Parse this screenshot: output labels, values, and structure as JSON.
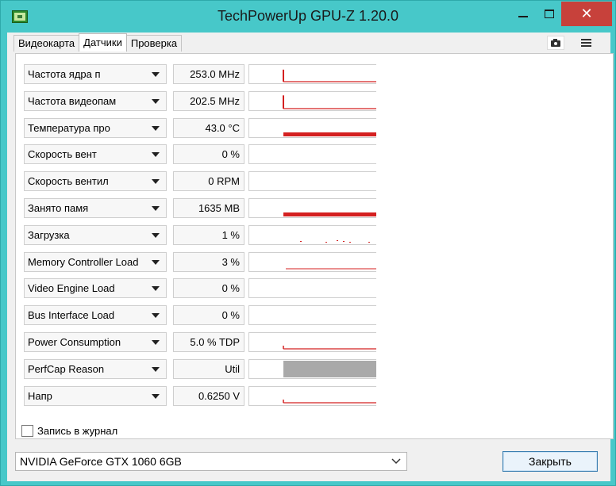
{
  "window": {
    "title": "TechPowerUp GPU-Z 1.20.0",
    "minimize_label": "",
    "maximize_label": "",
    "close_label": "✕"
  },
  "tabs": [
    {
      "label": "Видеокарта",
      "active": false
    },
    {
      "label": "Датчики",
      "active": true
    },
    {
      "label": "Проверка",
      "active": false
    }
  ],
  "toolbar": {
    "screenshot_icon": "camera-icon",
    "menu_icon": "hamburger-menu-icon"
  },
  "colors": {
    "graph_line": "#d42020",
    "perfcap_fill": "#a9a9a9",
    "titlebar": "#47c8c9",
    "close_button": "#c7413b"
  },
  "sensors": [
    {
      "name": "Частота ядра п",
      "value": "253.0 MHz",
      "graph": {
        "kind": "spike-low",
        "level": 0.78
      }
    },
    {
      "name": "Частота видеопам",
      "value": "202.5 MHz",
      "graph": {
        "kind": "spike-low",
        "level": 0.85
      }
    },
    {
      "name": "Температура про",
      "value": "43.0 °C",
      "graph": {
        "kind": "band",
        "level": 0.43
      }
    },
    {
      "name": "Скорость вент",
      "value": "0 %",
      "graph": {
        "kind": "none",
        "level": 0
      }
    },
    {
      "name": "Скорость вентил",
      "value": "0 RPM",
      "graph": {
        "kind": "none",
        "level": 0
      }
    },
    {
      "name": "Занято памя",
      "value": "1635 MB",
      "graph": {
        "kind": "band",
        "level": 0.27
      }
    },
    {
      "name": "Загрузка",
      "value": "1 %",
      "graph": {
        "kind": "dots",
        "level": 0.01
      }
    },
    {
      "name": "Memory Controller Load",
      "value": "3 %",
      "graph": {
        "kind": "thin",
        "level": 0.03
      }
    },
    {
      "name": "Video Engine Load",
      "value": "0 %",
      "graph": {
        "kind": "none",
        "level": 0
      }
    },
    {
      "name": "Bus Interface Load",
      "value": "0 %",
      "graph": {
        "kind": "none",
        "level": 0
      }
    },
    {
      "name": "Power Consumption",
      "value": "5.0 % TDP",
      "graph": {
        "kind": "thin-step",
        "level": 0.05
      }
    },
    {
      "name": "PerfCap Reason",
      "value": "Util",
      "graph": {
        "kind": "fill",
        "level": 1
      }
    },
    {
      "name": "Напр",
      "value": "0.6250 V",
      "graph": {
        "kind": "thin-step",
        "level": 0.06
      }
    }
  ],
  "log_to_file": {
    "label": "Запись в журнал",
    "checked": false
  },
  "gpu_select": {
    "selected": "NVIDIA GeForce GTX 1060 6GB"
  },
  "close_button": {
    "label": "Закрыть"
  }
}
